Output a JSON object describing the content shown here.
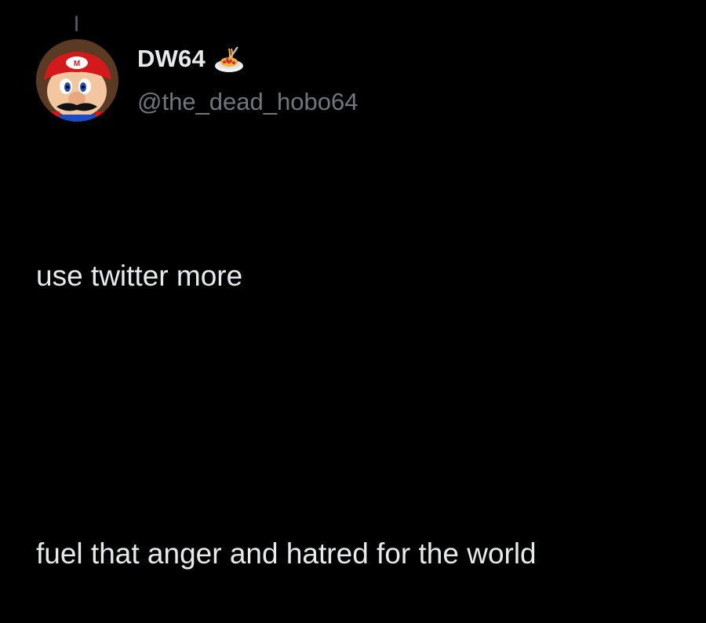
{
  "author": {
    "display_name": "DW64",
    "handle": "@the_dead_hobo64",
    "name_emoji": "spaghetti-icon",
    "avatar": "mario-face-avatar"
  },
  "tweet": {
    "lines": [
      "use twitter more",
      "",
      "fuel that anger and hatred for the world"
    ]
  },
  "colors": {
    "background": "#000000",
    "text_primary": "#e7e9ea",
    "text_secondary": "#71767b",
    "thread_line": "#4e5358"
  }
}
